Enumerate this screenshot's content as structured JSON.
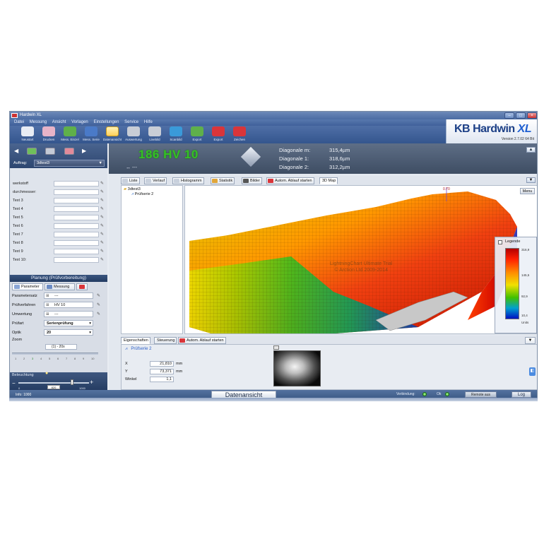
{
  "window": {
    "title": "Hardwin XL"
  },
  "menu": [
    "Datei",
    "Messung",
    "Ansicht",
    "Vorlagen",
    "Einstellungen",
    "Service",
    "Hilfe"
  ],
  "toolbar": [
    {
      "label": "Neustart",
      "color": "#e8ecf4"
    },
    {
      "label": "Drucken",
      "color": "#e7b3c8"
    },
    {
      "label": "Mess. Einzel",
      "color": "#5fb04a"
    },
    {
      "label": "Mess. Serie",
      "color": "#4a7ac8"
    },
    {
      "label": "Datenansicht",
      "color": "#ffd05a"
    },
    {
      "label": "Auswertung",
      "color": "#c8cdd6"
    },
    {
      "label": "Livebild",
      "color": "#c8cdd6"
    },
    {
      "label": "Scanbild",
      "color": "#3a9ad9"
    },
    {
      "label": "Export",
      "color": "#5fb04a"
    },
    {
      "label": "Export",
      "color": "#d9353a"
    },
    {
      "label": "Zeichen",
      "color": "#d9353a"
    }
  ],
  "brand": {
    "kb": "KB",
    "name": "Hardwin",
    "xl": "XL",
    "version": "Version 2.7.02   64 Bit"
  },
  "left": {
    "auftrag_label": "Auftrag:",
    "auftrag_value": "3dtest3",
    "fields": [
      "werkstoff",
      "durchmesser:",
      "Text 3",
      "Text 4",
      "Text 5",
      "Text 6",
      "Text 7",
      "Text 8",
      "Text 9",
      "Text 10:"
    ],
    "planung_title": "Planung (Prüfvorbereitung)",
    "tabs": [
      "Parameter",
      "Messung"
    ],
    "params": [
      {
        "label": "Parametersatz",
        "value": "---"
      },
      {
        "label": "Prüfverfahren",
        "value": "HV 10"
      },
      {
        "label": "Umwertung",
        "value": "---"
      },
      {
        "label": "Prüfart",
        "value": "Serienprüfung"
      },
      {
        "label": "Optik",
        "value": "20"
      }
    ],
    "zoom_label": "Zoom",
    "zoom_value": "(1) - 20x",
    "zoom_ticks": [
      "1",
      "2",
      "3",
      "4",
      "5",
      "6",
      "7",
      "8",
      "9",
      "10"
    ],
    "bel_label": "Beleuchtung",
    "bel_value": "820",
    "bel_min": "0",
    "bel_max": "1000",
    "status_left": "Info: 1000"
  },
  "result": {
    "hv": "186 HV 10",
    "sub": "↔ ---",
    "diag": [
      {
        "label": "Diagonale m:",
        "value": "315,4µm"
      },
      {
        "label": "Diagonale 1:",
        "value": "318,6µm"
      },
      {
        "label": "Diagonale 2:",
        "value": "312,2µm"
      }
    ]
  },
  "maintabs": [
    "Liste",
    "Verlauf",
    "Histogramm",
    "Statistik",
    "Bilder",
    "Autom. Ablauf starten",
    "3D Map"
  ],
  "tree": {
    "root": "3dtest3",
    "child": "Prüfserie 2"
  },
  "map": {
    "menu": "Menu",
    "legend_title": "Legende",
    "legend_values": [
      "316,9",
      "145,5",
      "92,9",
      "10,4",
      "Units"
    ],
    "watermark_1": "LightningChart Ultimate Trial",
    "watermark_2": "© Arction Ltd 2009-2014",
    "peak_label": "0.70"
  },
  "bottom": {
    "tabs": [
      "Eigenschaften",
      "Steuerung",
      "Autom. Ablauf starten"
    ],
    "series": "Prüfserie 2",
    "x_label": "X",
    "x_value": "21,810",
    "x_unit": "mm",
    "y_label": "Y",
    "y_value": "73,371",
    "y_unit": "mm",
    "w_label": "Winkel",
    "w_value": "1,1"
  },
  "status": {
    "datenansicht": "Datenansicht",
    "verbindung": "Verbindung:",
    "ok": "Ok",
    "remote": "Remote aus",
    "log": "Log"
  }
}
